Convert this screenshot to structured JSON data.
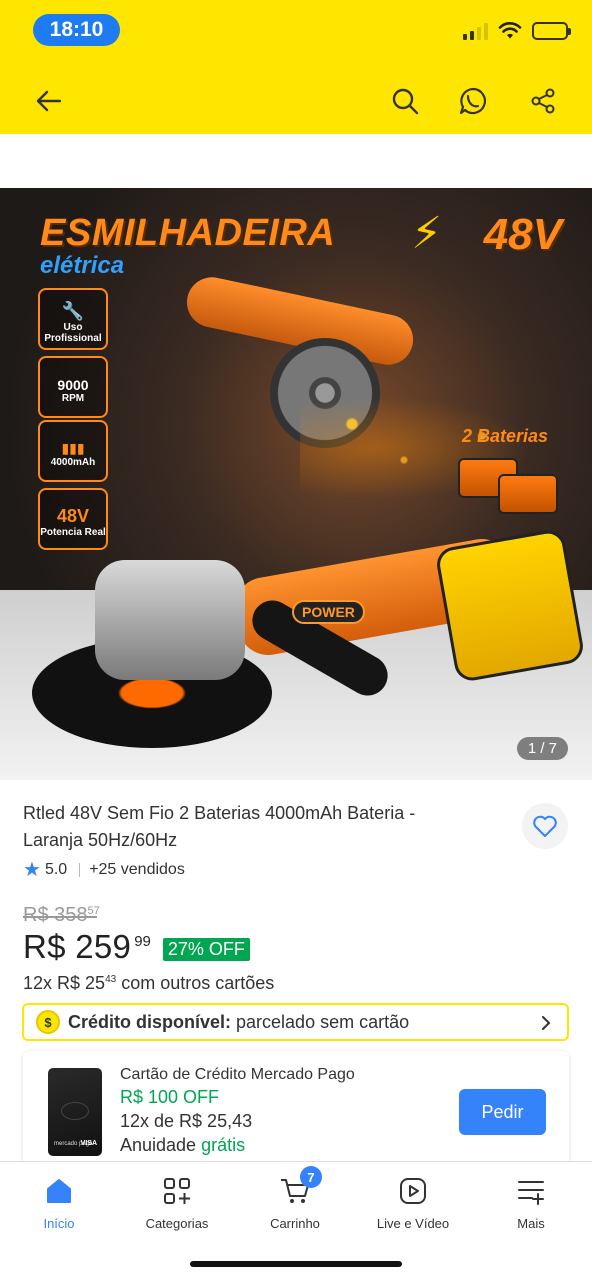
{
  "status_bar": {
    "time": "18:10"
  },
  "header": {
    "back_icon": "arrow-left-icon",
    "search_icon": "search-icon",
    "whatsapp_icon": "whatsapp-icon",
    "share_icon": "share-icon"
  },
  "hero": {
    "title": "ESMILHADEIRA",
    "subtitle": "elétrica",
    "voltage": "48V",
    "badges": [
      {
        "big": "",
        "small": "Uso Profissional"
      },
      {
        "big": "9000",
        "small": "RPM"
      },
      {
        "big": "",
        "small": "4000mAh"
      },
      {
        "big": "48V",
        "small": "Potencia Real"
      }
    ],
    "batteries_label": "2 Baterias",
    "power_label": "POWER",
    "counter": "1 / 7"
  },
  "product": {
    "title": "Rtled 48V Sem Fio 2 Baterias 4000mAh Bateria - Laranja 50Hz/60Hz",
    "rating": "5.0",
    "sold": "+25 vendidos",
    "old_price": "R$ 358",
    "old_cents": "57",
    "price": "R$ 259",
    "price_cents": "99",
    "discount": "27% OFF",
    "installments_prefix": "12x R$ 25",
    "installments_cents": "43",
    "installments_suffix": " com outros cartões"
  },
  "credit": {
    "label_bold": "Crédito disponível:",
    "label_rest": " parcelado sem cartão"
  },
  "card_offer": {
    "title": "Cartão de Crédito Mercado Pago",
    "off": "R$ 100 OFF",
    "installments": "12x de R$ 25,43",
    "fee_prefix": "Anuidade ",
    "fee_green": "grátis",
    "button": "Pedir",
    "card_brand": "VISA",
    "card_issuer": "mercado pago"
  },
  "bottom_nav": {
    "items": [
      {
        "label": "Início",
        "icon": "home-icon"
      },
      {
        "label": "Categorias",
        "icon": "categories-icon"
      },
      {
        "label": "Carrinho",
        "icon": "cart-icon"
      },
      {
        "label": "Live e Vídeo",
        "icon": "video-icon"
      },
      {
        "label": "Mais",
        "icon": "more-icon"
      }
    ],
    "cart_count": "7"
  },
  "colors": {
    "brand_yellow": "#ffe600",
    "accent_blue": "#3483fa",
    "green": "#00a650"
  }
}
